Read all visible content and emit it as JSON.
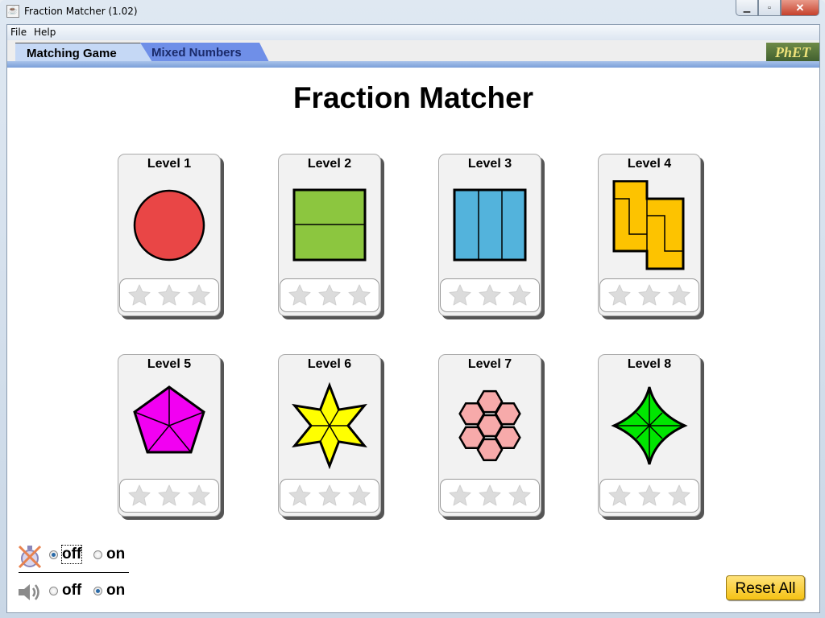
{
  "window": {
    "title": "Fraction Matcher (1.02)"
  },
  "menu": {
    "items": [
      "File",
      "Help"
    ]
  },
  "tabs": [
    {
      "label": "Matching Game",
      "active": true
    },
    {
      "label": "Mixed Numbers",
      "active": false
    }
  ],
  "logo": "PhET",
  "page_title": "Fraction Matcher",
  "levels": [
    {
      "label": "Level 1",
      "shape": "circle",
      "pieces": 1,
      "color": "#e94646",
      "stars_earned": 0,
      "stars_total": 3
    },
    {
      "label": "Level 2",
      "shape": "square-horizontal-halves",
      "pieces": 2,
      "color": "#8cc63f",
      "stars_earned": 0,
      "stars_total": 3
    },
    {
      "label": "Level 3",
      "shape": "square-vertical-thirds",
      "pieces": 3,
      "color": "#53b3dc",
      "stars_earned": 0,
      "stars_total": 3
    },
    {
      "label": "Level 4",
      "shape": "tetromino-pair",
      "pieces": 4,
      "color": "#fdc300",
      "stars_earned": 0,
      "stars_total": 3
    },
    {
      "label": "Level 5",
      "shape": "pentagon",
      "pieces": 5,
      "color": "#f200f2",
      "stars_earned": 0,
      "stars_total": 3
    },
    {
      "label": "Level 6",
      "shape": "six-point-star",
      "pieces": 6,
      "color": "#ffff00",
      "stars_earned": 0,
      "stars_total": 3
    },
    {
      "label": "Level 7",
      "shape": "hexagon-cluster",
      "pieces": 7,
      "color": "#f7aaaa",
      "stars_earned": 0,
      "stars_total": 3
    },
    {
      "label": "Level 8",
      "shape": "four-point-star",
      "pieces": 8,
      "color": "#00e600",
      "stars_earned": 0,
      "stars_total": 3
    }
  ],
  "controls": {
    "timer": {
      "icon": "stopwatch-disabled-icon",
      "options": [
        "off",
        "on"
      ],
      "selected": "off"
    },
    "sound": {
      "icon": "speaker-icon",
      "options": [
        "off",
        "on"
      ],
      "selected": "on"
    }
  },
  "reset_button": "Reset All"
}
